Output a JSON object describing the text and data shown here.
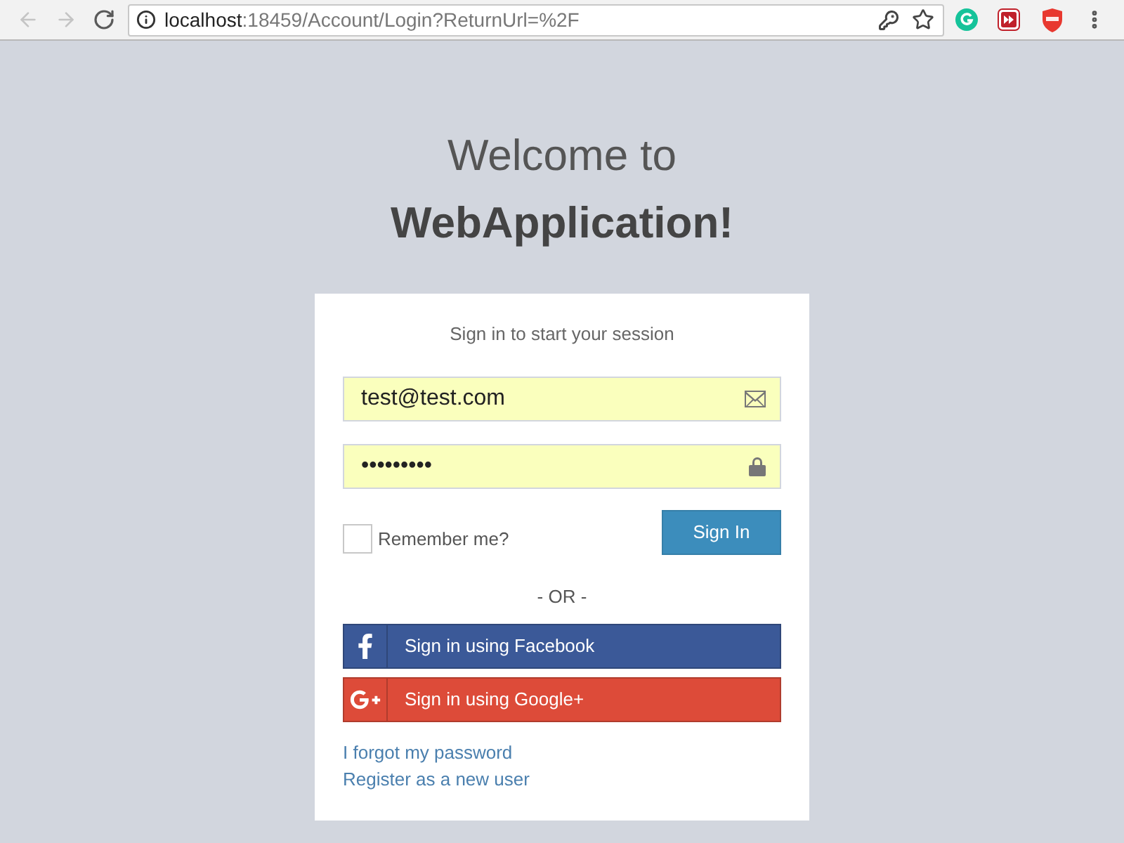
{
  "browser": {
    "back": {
      "disabled": true
    },
    "forward": {
      "disabled": true
    },
    "address": {
      "host": "localhost",
      "path": ":18459/Account/Login?ReturnUrl=%2F"
    }
  },
  "heading": {
    "line_1": "Welcome to",
    "line_2": "WebApplication!"
  },
  "login_box": {
    "message": "Sign in to start your session",
    "fields": [
      {
        "kind": "email",
        "value": "test@test.com"
      },
      {
        "kind": "password",
        "value": "•••••••••"
      }
    ],
    "remember": {
      "label": "Remember me?",
      "checked": false
    },
    "submit": "Sign In",
    "separator": "- OR -",
    "social": [
      {
        "kind": "facebook",
        "label": "Sign in using Facebook"
      },
      {
        "kind": "google",
        "label": "Sign in using Google+"
      }
    ],
    "links": [
      "I forgot my password",
      "Register as a new user"
    ]
  }
}
